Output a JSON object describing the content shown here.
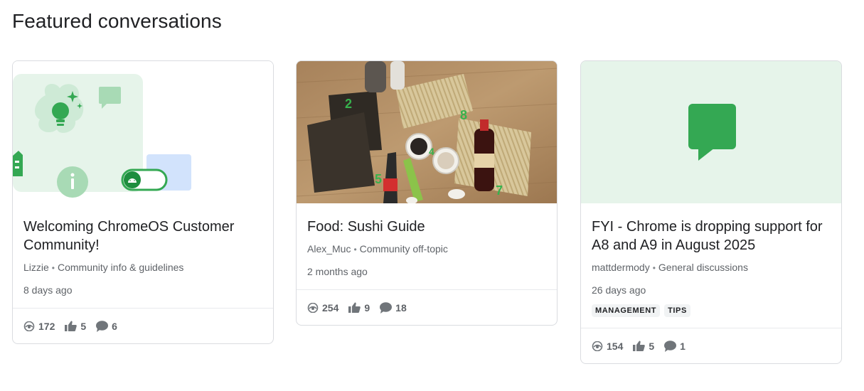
{
  "section": {
    "title": "Featured conversations"
  },
  "cards": [
    {
      "title": "Welcoming ChromeOS Customer Community!",
      "author": "Lizzie",
      "category": "Community info & guidelines",
      "time": "8 days ago",
      "tags": [],
      "stats": {
        "views": "172",
        "likes": "5",
        "replies": "6"
      }
    },
    {
      "title": "Food: Sushi Guide",
      "author": "Alex_Muc",
      "category": "Community off-topic",
      "time": "2 months ago",
      "tags": [],
      "stats": {
        "views": "254",
        "likes": "9",
        "replies": "18"
      }
    },
    {
      "title": "FYI - Chrome is dropping support for A8 and A9 in August 2025",
      "author": "mattdermody",
      "category": "General discussions",
      "time": "26 days ago",
      "tags": [
        "MANAGEMENT",
        "TIPS"
      ],
      "stats": {
        "views": "154",
        "likes": "5",
        "replies": "1"
      }
    }
  ],
  "colors": {
    "accent_green": "#34a853",
    "light_green": "#e6f4ea",
    "icon_gray": "#70757a"
  },
  "icons": {
    "views": "eye-icon",
    "likes": "thumbs-up-icon",
    "replies": "comment-icon"
  }
}
